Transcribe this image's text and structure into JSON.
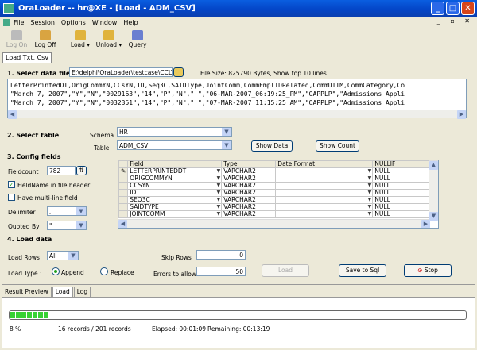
{
  "window": {
    "title": "OraLoader -- hr@XE - [Load - ADM_CSV]"
  },
  "menu": [
    "File",
    "Session",
    "Options",
    "Window",
    "Help"
  ],
  "toolbar": {
    "logon": "Log On",
    "logoff": "Log Off",
    "load": "Load",
    "unload": "Unload",
    "query": "Query"
  },
  "doc_tab": "Load Txt, Csv",
  "section1": {
    "title": "1. Select data file",
    "path": "E:\\delphi\\OraLoader\\testcase\\CCLTF",
    "file_info": "File Size: 825790 Bytes,  Show top 10 lines",
    "lines": [
      "LetterPrintedDT,OrigCommYN,CCsYN,ID,Seq3C,SAIDType,JointComm,CommEmplIDRelated,CommDTTM,CommCategory,Co",
      "\"March 7, 2007\",\"Y\",\"N\",\"0029163\",\"14\",\"P\",\"N\",\" \",\"06-MAR-2007_06:19:25_PM\",\"OAPPLP\",\"Admissions Appli",
      "\"March 7, 2007\",\"Y\",\"N\",\"0032351\",\"14\",\"P\",\"N\",\" \",\"07-MAR-2007_11:15:25_AM\",\"OAPPLP\",\"Admissions Appli"
    ]
  },
  "section2": {
    "title": "2. Select table",
    "schema_label": "Schema",
    "schema": "HR",
    "table_label": "Table",
    "table": "ADM_CSV",
    "show_data": "Show Data",
    "show_count": "Show Count"
  },
  "section3": {
    "title": "3. Config fields",
    "fieldcount_label": "Fieldcount",
    "fieldcount": "782",
    "fieldname_header": "FieldName in file header",
    "multiline": "Have multi-line field",
    "delimiter_label": "Delimiter",
    "delimiter": ",",
    "quoted_label": "Quoted By",
    "quoted": "\"",
    "columns": [
      "Field",
      "Type",
      "Date Format",
      "NULLIF"
    ],
    "rows": [
      {
        "field": "LETTERPRINTEDDT",
        "type": "VARCHAR2",
        "fmt": "",
        "nullif": "NULL"
      },
      {
        "field": "ORIGCOMMYN",
        "type": "VARCHAR2",
        "fmt": "",
        "nullif": "NULL"
      },
      {
        "field": "CCSYN",
        "type": "VARCHAR2",
        "fmt": "",
        "nullif": "NULL"
      },
      {
        "field": "ID",
        "type": "VARCHAR2",
        "fmt": "",
        "nullif": "NULL"
      },
      {
        "field": "SEQ3C",
        "type": "VARCHAR2",
        "fmt": "",
        "nullif": "NULL"
      },
      {
        "field": "SAIDTYPE",
        "type": "VARCHAR2",
        "fmt": "",
        "nullif": "NULL"
      },
      {
        "field": "JOINTCOMM",
        "type": "VARCHAR2",
        "fmt": "",
        "nullif": "NULL"
      }
    ]
  },
  "section4": {
    "title": "4. Load data",
    "load_rows_label": "Load Rows",
    "load_rows": "All",
    "skip_rows_label": "Skip Rows",
    "skip_rows": "0",
    "load_type_label": "Load Type :",
    "append": "Append",
    "replace": "Replace",
    "errors_label": "Errors to allow",
    "errors": "50",
    "load_btn": "Load",
    "save_btn": "Save to Sql",
    "stop_btn": "Stop"
  },
  "bottom_tabs": [
    "Result Preview",
    "Load",
    "Log"
  ],
  "status": {
    "percent": "8 %",
    "records": "16 records / 201 records",
    "elapsed": "Elapsed: 00:01:09",
    "remaining": "Remaining: 00:13:19",
    "progress": 0.08
  },
  "colors": {
    "progress": "#37d133",
    "title_bar": "#0a5ee0"
  }
}
